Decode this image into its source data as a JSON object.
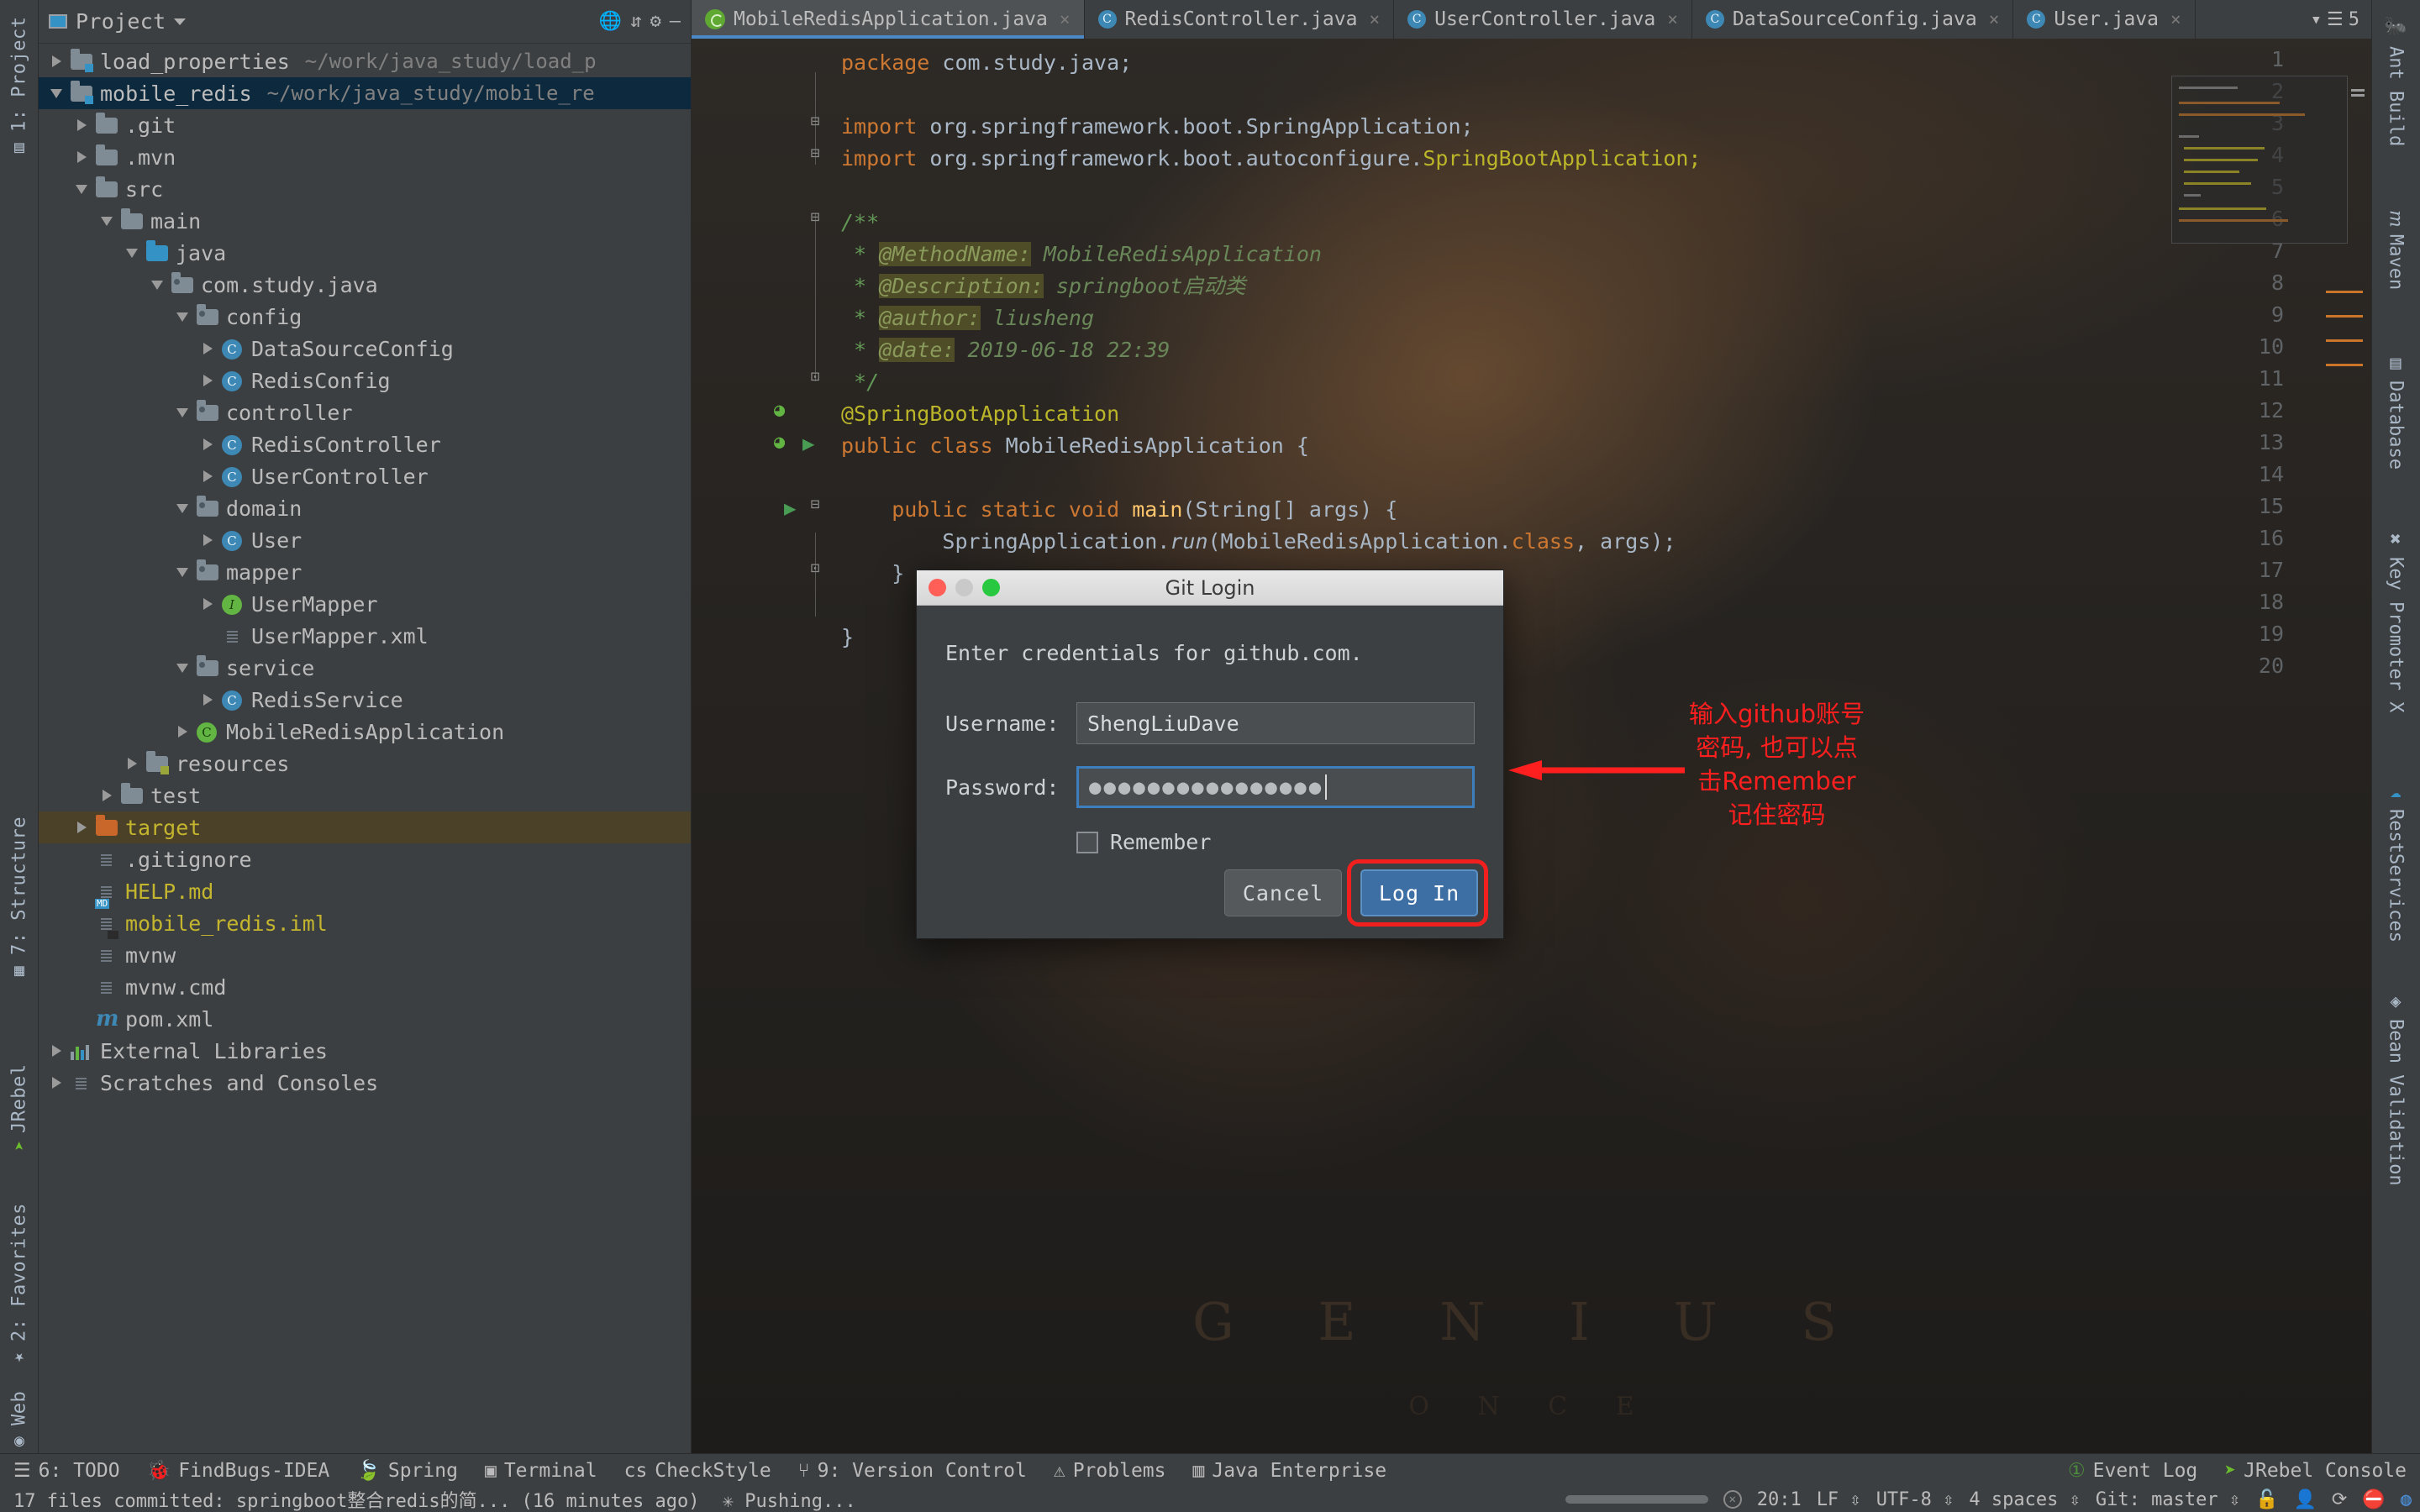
{
  "left_strip": [
    {
      "label": "1: Project",
      "icon": "project-icon"
    },
    {
      "label": "7: Structure",
      "icon": "structure-icon"
    },
    {
      "label": "JRebel",
      "icon": "jrebel-icon"
    },
    {
      "label": "2: Favorites",
      "icon": "star-icon"
    },
    {
      "label": "Web",
      "icon": "web-icon"
    }
  ],
  "right_strip": [
    {
      "label": "Ant Build",
      "icon": "ant-icon"
    },
    {
      "label": "Maven",
      "icon": "maven-icon"
    },
    {
      "label": "Database",
      "icon": "database-icon"
    },
    {
      "label": "Key Promoter X",
      "icon": "key-promoter-icon"
    },
    {
      "label": "RestServices",
      "icon": "rest-services-icon"
    },
    {
      "label": "Bean Validation",
      "icon": "bean-validation-icon"
    }
  ],
  "project_panel": {
    "title": "Project",
    "header_icons": [
      "globe-icon",
      "collapse-all-icon",
      "gear-icon",
      "minimize-icon"
    ],
    "tree": [
      {
        "indent": 0,
        "arrow": "right",
        "icon": "module-folder",
        "label": "load_properties",
        "path": "~/work/java_study/load_p",
        "state": "normal"
      },
      {
        "indent": 0,
        "arrow": "down",
        "icon": "module-folder",
        "label": "mobile_redis",
        "path": "~/work/java_study/mobile_re",
        "state": "selected"
      },
      {
        "indent": 1,
        "arrow": "right",
        "icon": "folder",
        "label": ".git",
        "path": "",
        "state": "normal"
      },
      {
        "indent": 1,
        "arrow": "right",
        "icon": "folder",
        "label": ".mvn",
        "path": "",
        "state": "normal"
      },
      {
        "indent": 1,
        "arrow": "down",
        "icon": "folder",
        "label": "src",
        "path": "",
        "state": "normal"
      },
      {
        "indent": 2,
        "arrow": "down",
        "icon": "folder",
        "label": "main",
        "path": "",
        "state": "normal"
      },
      {
        "indent": 3,
        "arrow": "down",
        "icon": "folder-source",
        "label": "java",
        "path": "",
        "state": "normal"
      },
      {
        "indent": 4,
        "arrow": "down",
        "icon": "folder-package",
        "label": "com.study.java",
        "path": "",
        "state": "normal"
      },
      {
        "indent": 5,
        "arrow": "down",
        "icon": "folder-package",
        "label": "config",
        "path": "",
        "state": "normal"
      },
      {
        "indent": 6,
        "arrow": "right",
        "icon": "class-icon",
        "label": "DataSourceConfig",
        "path": "",
        "state": "normal"
      },
      {
        "indent": 6,
        "arrow": "right",
        "icon": "class-icon",
        "label": "RedisConfig",
        "path": "",
        "state": "normal"
      },
      {
        "indent": 5,
        "arrow": "down",
        "icon": "folder-package",
        "label": "controller",
        "path": "",
        "state": "normal"
      },
      {
        "indent": 6,
        "arrow": "right",
        "icon": "class-icon",
        "label": "RedisController",
        "path": "",
        "state": "normal"
      },
      {
        "indent": 6,
        "arrow": "right",
        "icon": "class-icon",
        "label": "UserController",
        "path": "",
        "state": "normal"
      },
      {
        "indent": 5,
        "arrow": "down",
        "icon": "folder-package",
        "label": "domain",
        "path": "",
        "state": "normal"
      },
      {
        "indent": 6,
        "arrow": "right",
        "icon": "class-icon",
        "label": "User",
        "path": "",
        "state": "normal"
      },
      {
        "indent": 5,
        "arrow": "down",
        "icon": "folder-package",
        "label": "mapper",
        "path": "",
        "state": "normal"
      },
      {
        "indent": 6,
        "arrow": "right",
        "icon": "interface-icon",
        "label": "UserMapper",
        "path": "",
        "state": "normal"
      },
      {
        "indent": 6,
        "arrow": "none",
        "icon": "xml-file-icon",
        "label": "UserMapper.xml",
        "path": "",
        "state": "normal"
      },
      {
        "indent": 5,
        "arrow": "down",
        "icon": "folder-package",
        "label": "service",
        "path": "",
        "state": "normal"
      },
      {
        "indent": 6,
        "arrow": "right",
        "icon": "class-icon",
        "label": "RedisService",
        "path": "",
        "state": "normal"
      },
      {
        "indent": 5,
        "arrow": "right",
        "icon": "spring-class-icon",
        "label": "MobileRedisApplication",
        "path": "",
        "state": "normal"
      },
      {
        "indent": 3,
        "arrow": "right",
        "icon": "folder-resources",
        "label": "resources",
        "path": "",
        "state": "normal"
      },
      {
        "indent": 2,
        "arrow": "right",
        "icon": "folder",
        "label": "test",
        "path": "",
        "state": "normal"
      },
      {
        "indent": 1,
        "arrow": "right",
        "icon": "folder-excluded",
        "label": "target",
        "path": "",
        "state": "highlighted"
      },
      {
        "indent": 1,
        "arrow": "none",
        "icon": "text-file-icon",
        "label": ".gitignore",
        "path": "",
        "state": "normal"
      },
      {
        "indent": 1,
        "arrow": "none",
        "icon": "md-file-icon",
        "label": "HELP.md",
        "path": "",
        "state": "yellow"
      },
      {
        "indent": 1,
        "arrow": "none",
        "icon": "iml-file-icon",
        "label": "mobile_redis.iml",
        "path": "",
        "state": "yellow"
      },
      {
        "indent": 1,
        "arrow": "none",
        "icon": "text-file-icon",
        "label": "mvnw",
        "path": "",
        "state": "normal"
      },
      {
        "indent": 1,
        "arrow": "none",
        "icon": "text-file-icon",
        "label": "mvnw.cmd",
        "path": "",
        "state": "normal"
      },
      {
        "indent": 1,
        "arrow": "none",
        "icon": "maven-file-icon",
        "label": "pom.xml",
        "path": "",
        "state": "normal"
      },
      {
        "indent": 0,
        "arrow": "right",
        "icon": "libraries-icon",
        "label": "External Libraries",
        "path": "",
        "state": "normal"
      },
      {
        "indent": 0,
        "arrow": "right",
        "icon": "scratches-icon",
        "label": "Scratches and Consoles",
        "path": "",
        "state": "normal"
      }
    ]
  },
  "editor": {
    "tabs": [
      {
        "label": "MobileRedisApplication.java",
        "icon": "spring-class-icon",
        "active": true,
        "close": "×"
      },
      {
        "label": "RedisController.java",
        "icon": "class-icon",
        "active": false,
        "close": "×"
      },
      {
        "label": "UserController.java",
        "icon": "class-icon",
        "active": false,
        "close": "×"
      },
      {
        "label": "DataSourceConfig.java",
        "icon": "class-icon",
        "active": false,
        "close": "×"
      },
      {
        "label": "User.java",
        "icon": "class-icon",
        "active": false,
        "close": "×"
      }
    ],
    "tab_overflow": "5",
    "line_numbers": [
      "1",
      "2",
      "3",
      "4",
      "5",
      "6",
      "7",
      "8",
      "9",
      "10",
      "11",
      "12",
      "13",
      "14",
      "15",
      "16",
      "17",
      "18",
      "19",
      "20"
    ],
    "code_lines": [
      {
        "n": 1,
        "segments": [
          {
            "t": "package ",
            "c": "k"
          },
          {
            "t": "com.study.java;",
            "c": "s"
          }
        ]
      },
      {
        "n": 2,
        "segments": []
      },
      {
        "n": 3,
        "segments": [
          {
            "t": "import ",
            "c": "k"
          },
          {
            "t": "org.springframework.boot.SpringApplication;",
            "c": "s"
          }
        ]
      },
      {
        "n": 4,
        "segments": [
          {
            "t": "import ",
            "c": "k"
          },
          {
            "t": "org.springframework.boot.autoconfigure.",
            "c": "s"
          },
          {
            "t": "SpringBootApplication;",
            "c": "hl-ident"
          }
        ]
      },
      {
        "n": 5,
        "segments": []
      },
      {
        "n": 6,
        "segments": [
          {
            "t": "/**",
            "c": "c"
          }
        ]
      },
      {
        "n": 7,
        "segments": [
          {
            "t": " * ",
            "c": "c"
          },
          {
            "t": "@MethodName:",
            "c": "tag"
          },
          {
            "t": " MobileRedisApplication",
            "c": "val"
          }
        ]
      },
      {
        "n": 8,
        "segments": [
          {
            "t": " * ",
            "c": "c"
          },
          {
            "t": "@Description:",
            "c": "tag"
          },
          {
            "t": " springboot启动类",
            "c": "val"
          }
        ]
      },
      {
        "n": 9,
        "segments": [
          {
            "t": " * ",
            "c": "c"
          },
          {
            "t": "@author:",
            "c": "tag"
          },
          {
            "t": " liusheng",
            "c": "val"
          }
        ]
      },
      {
        "n": 10,
        "segments": [
          {
            "t": " * ",
            "c": "c"
          },
          {
            "t": "@date:",
            "c": "tag"
          },
          {
            "t": " 2019-06-18 22:39",
            "c": "val"
          }
        ]
      },
      {
        "n": 11,
        "segments": [
          {
            "t": " */",
            "c": "c"
          }
        ]
      },
      {
        "n": 12,
        "segments": [
          {
            "t": "@SpringBootApplication",
            "c": "y"
          }
        ]
      },
      {
        "n": 13,
        "segments": [
          {
            "t": "public class ",
            "c": "k"
          },
          {
            "t": "MobileRedisApplication {",
            "c": "s"
          }
        ]
      },
      {
        "n": 14,
        "segments": []
      },
      {
        "n": 15,
        "segments": [
          {
            "t": "    public static void ",
            "c": "k"
          },
          {
            "t": "main",
            "c": "m"
          },
          {
            "t": "(String[] args) {",
            "c": "s"
          }
        ]
      },
      {
        "n": 16,
        "segments": [
          {
            "t": "        SpringApplication.",
            "c": "s"
          },
          {
            "t": "run",
            "c": "s-italic"
          },
          {
            "t": "(MobileRedisApplication.",
            "c": "s"
          },
          {
            "t": "class",
            "c": "k"
          },
          {
            "t": ", args);",
            "c": "s"
          }
        ]
      },
      {
        "n": 17,
        "segments": [
          {
            "t": "    }",
            "c": "s"
          }
        ]
      },
      {
        "n": 18,
        "segments": []
      },
      {
        "n": 19,
        "segments": [
          {
            "t": "}",
            "c": "s"
          }
        ]
      },
      {
        "n": 20,
        "segments": []
      }
    ],
    "background_watermark": "G E N I U S",
    "background_watermark2": "O N C E"
  },
  "dialog": {
    "title": "Git Login",
    "message": "Enter credentials for github.com.",
    "username_label": "Username:",
    "username_value": "ShengLiuDave",
    "password_label": "Password:",
    "password_value": "●●●●●●●●●●●●●●●●",
    "remember_label": "Remember",
    "remember_checked": false,
    "cancel_label": "Cancel",
    "login_label": "Log In",
    "traffic_lights": [
      "close",
      "minimize",
      "zoom"
    ]
  },
  "annotation": {
    "lines": [
      "输入github账号",
      "密码, 也可以点",
      "击Remember",
      "记住密码"
    ],
    "color": "#ff1f1f"
  },
  "bottom_toolbar": [
    {
      "label": "6: TODO",
      "icon": "todo-icon"
    },
    {
      "label": "FindBugs-IDEA",
      "icon": "findbugs-icon"
    },
    {
      "label": "Spring",
      "icon": "spring-leaf-icon"
    },
    {
      "label": "Terminal",
      "icon": "terminal-icon"
    },
    {
      "label": "CheckStyle",
      "icon": "checkstyle-icon"
    },
    {
      "label": "9: Version Control",
      "icon": "branch-icon"
    },
    {
      "label": "Problems",
      "icon": "warning-icon"
    },
    {
      "label": "Java Enterprise",
      "icon": "jee-icon"
    },
    {
      "label": "Event Log",
      "icon": "event-log-badge",
      "badge": "1"
    },
    {
      "label": "JRebel Console",
      "icon": "jrebel-icon"
    }
  ],
  "status_bar": {
    "message": "17 files committed: springboot整合redis的简... (16 minutes ago)",
    "progress_text": "Pushing...",
    "caret": "20:1",
    "line_sep": "LF",
    "encoding": "UTF-8",
    "indent": "4 spaces",
    "git_branch": "Git: master",
    "icons": [
      "lock-icon",
      "hat-icon",
      "sync-icon",
      "error-icon",
      "google-icon"
    ]
  },
  "colors": {
    "accent": "#3592c4",
    "panel": "#3c3f41",
    "editor_bg": "#2b2b2b",
    "selection": "#0d293e",
    "highlight": "#4b4129",
    "annotation_red": "#ff1f1f",
    "login_button": "#3d6fa5",
    "keyword": "#cc7832",
    "string": "#a9b7c6",
    "annotation_yellow": "#bbb529",
    "comment": "#629755"
  }
}
